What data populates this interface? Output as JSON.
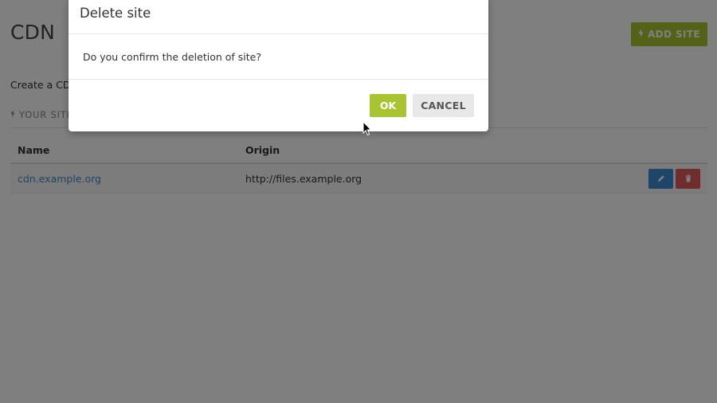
{
  "page": {
    "title": "CDN",
    "add_site_label": "ADD SITE",
    "intro_text": "Create a CDN site to deliver your content.",
    "section_heading": "YOUR SITES"
  },
  "table": {
    "columns": [
      "Name",
      "Origin"
    ],
    "rows": [
      {
        "name": "cdn.example.org",
        "origin": "http://files.example.org"
      }
    ]
  },
  "modal": {
    "title": "Delete site",
    "message": "Do you confirm the deletion of site?",
    "ok_label": "OK",
    "cancel_label": "CANCEL"
  },
  "icons": {
    "add_site": "bolt-icon",
    "section": "bolt-icon",
    "edit": "pencil-icon",
    "delete": "trash-icon",
    "cursor": "mouse-pointer-icon"
  },
  "colors": {
    "primary_green": "#a8c531",
    "edit_blue": "#3a8dd0",
    "delete_red": "#e05a5a",
    "link_blue": "#3a8dc5"
  }
}
